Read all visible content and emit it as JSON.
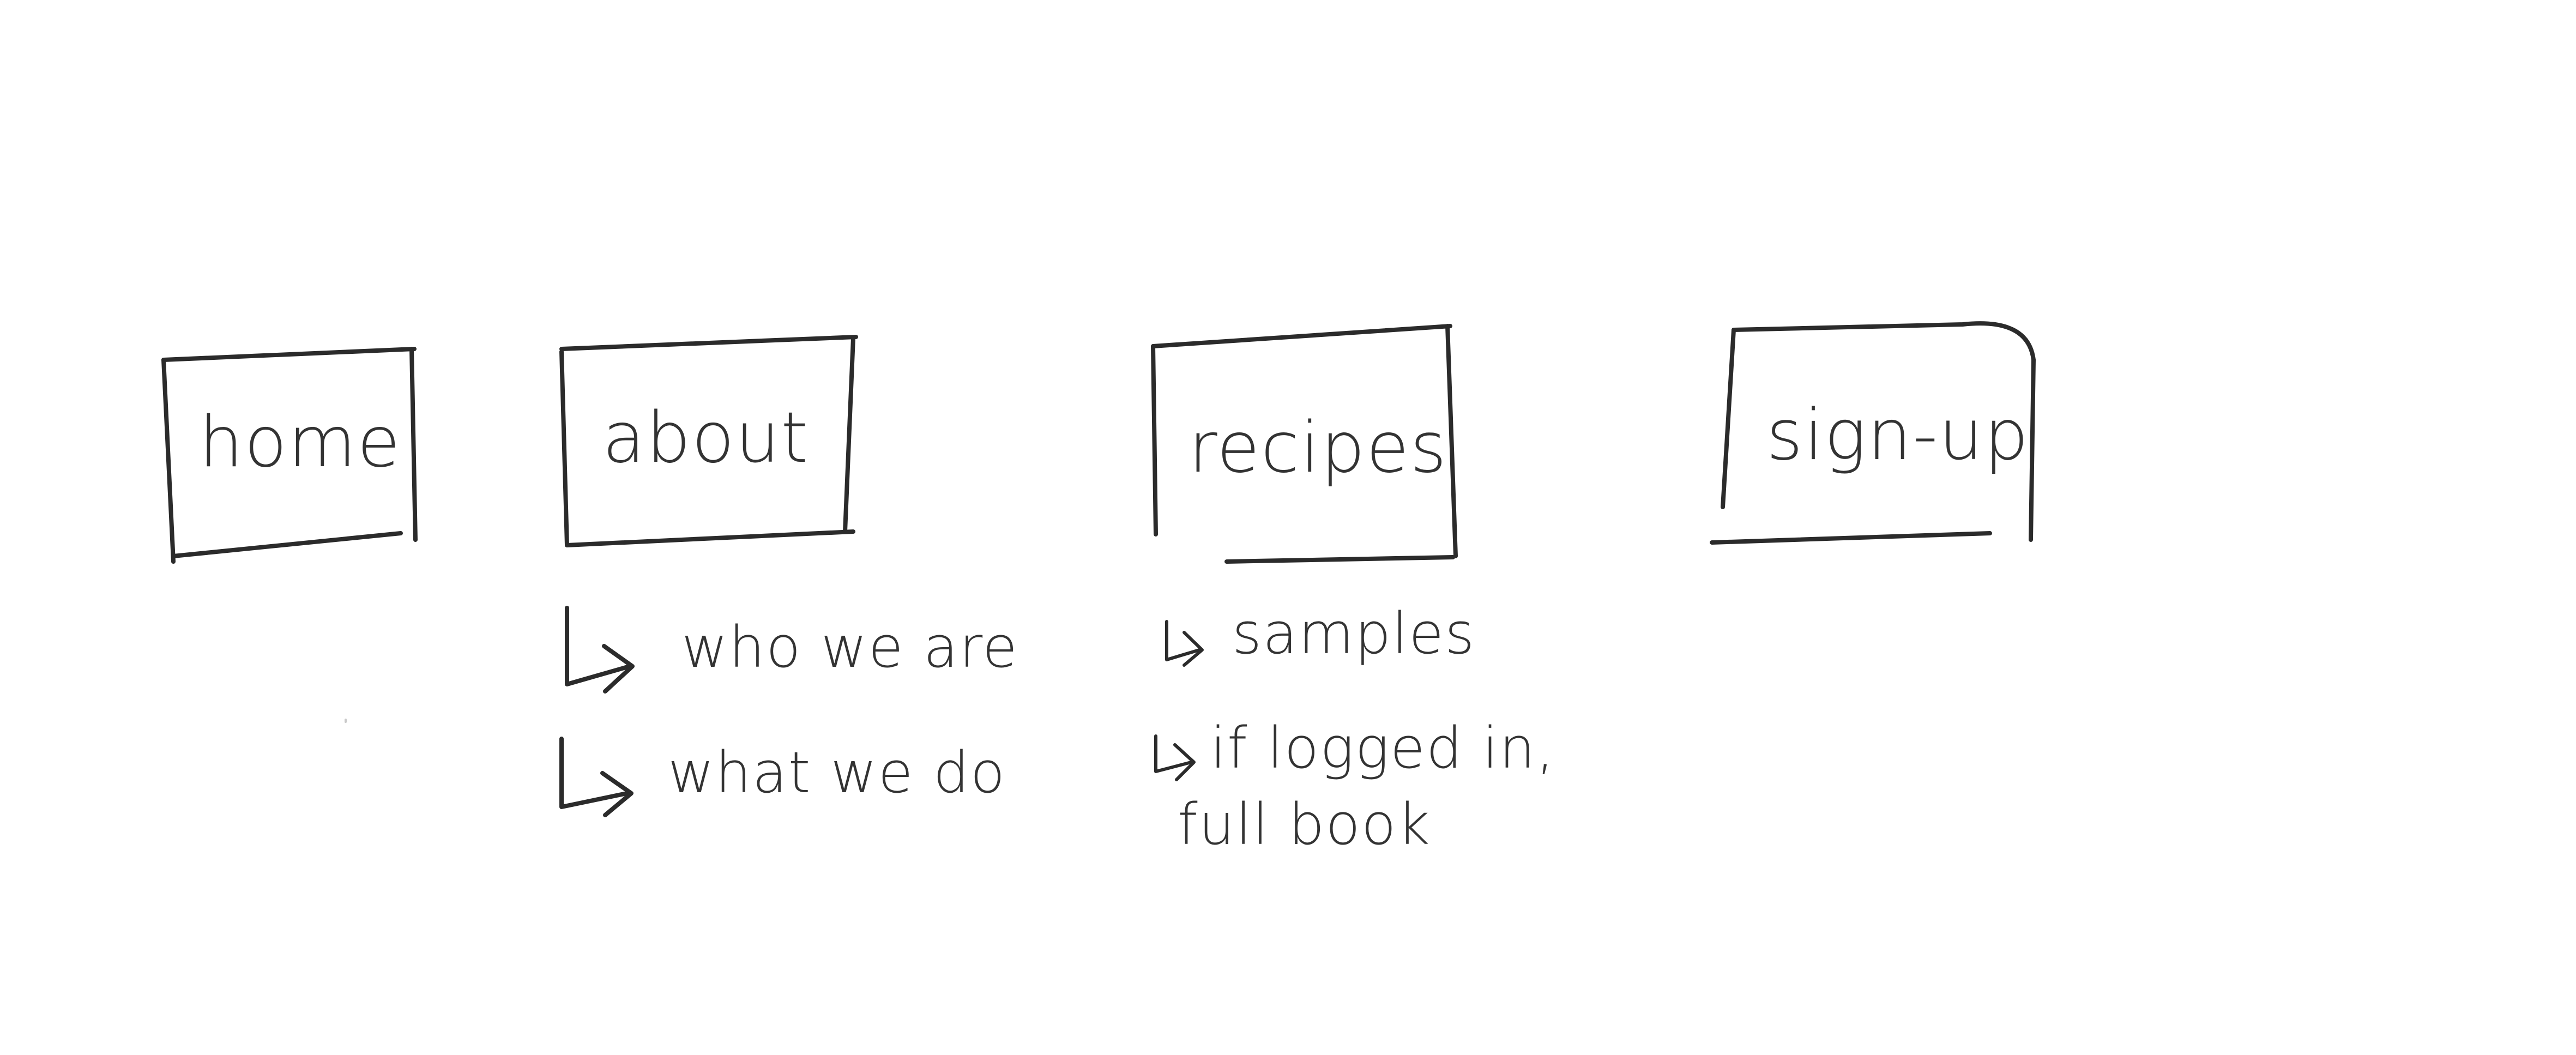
{
  "nav": {
    "home": {
      "label": "home"
    },
    "about": {
      "label": "about"
    },
    "recipes": {
      "label": "recipes"
    },
    "signup": {
      "label": "sign-up"
    }
  },
  "about_children": [
    {
      "label": "who we are"
    },
    {
      "label": "what we do"
    }
  ],
  "recipes_children": [
    {
      "label": "samples"
    },
    {
      "label": "if logged in,",
      "label_line2": "full book"
    }
  ],
  "colors": {
    "ink": "#2b2b2b",
    "paper": "#ffffff"
  },
  "icons": {
    "child_arrow": "hooked-right-arrow-icon"
  }
}
